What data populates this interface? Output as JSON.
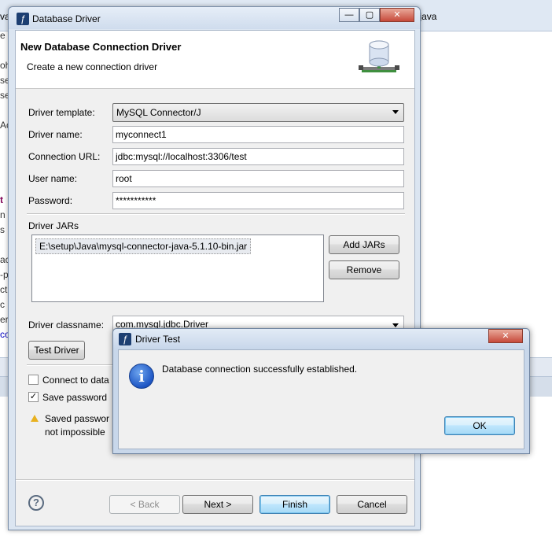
{
  "ide": {
    "left_tab_fragment": "va",
    "right_tab_fragment": "y.java",
    "code_fragments": [
      "e",
      "oh",
      "se",
      "se",
      "Ac",
      "t",
      "n",
      "s",
      "ac",
      "-p",
      "ct",
      "c",
      "er",
      "co"
    ]
  },
  "main_dialog": {
    "window_title": "Database Driver",
    "window_buttons": {
      "minimize": "—",
      "maximize": "▢",
      "close": "✕"
    },
    "header": {
      "title": "New Database Connection Driver",
      "subtitle": "Create a new connection driver",
      "icon": "database-connection-icon"
    },
    "form": {
      "driver_template_label": "Driver template:",
      "driver_template_value": "MySQL Connector/J",
      "driver_name_label": "Driver name:",
      "driver_name_value": "myconnect1",
      "connection_url_label": "Connection URL:",
      "connection_url_value": "jdbc:mysql://localhost:3306/test",
      "user_name_label": "User name:",
      "user_name_value": "root",
      "password_label": "Password:",
      "password_value": "***********"
    },
    "jars": {
      "section_label": "Driver JARs",
      "items": [
        "E:\\setup\\Java\\mysql-connector-java-5.1.10-bin.jar"
      ],
      "add_button": "Add JARs",
      "remove_button": "Remove"
    },
    "classname": {
      "label": "Driver classname:",
      "value": "com.mysql.jdbc.Driver"
    },
    "test_driver_button": "Test Driver",
    "connect_checkbox": {
      "label": "Connect to data",
      "checked": false
    },
    "save_password_checkbox": {
      "label": "Save password",
      "checked": true
    },
    "warning": {
      "line1": "Saved passwor",
      "line2": "not impossible"
    },
    "footer": {
      "back": "< Back",
      "next": "Next >",
      "finish": "Finish",
      "cancel": "Cancel",
      "help_icon": "help-icon"
    }
  },
  "test_dialog": {
    "window_title": "Driver Test",
    "message": "Database connection successfully established.",
    "ok_button": "OK",
    "icon": "info-icon"
  },
  "colors": {
    "dialog_frame": "#dbe5f1",
    "primary_button_border": "#3c7fb1",
    "close_button": "#c6493a",
    "info_icon": "#1e56c4"
  }
}
